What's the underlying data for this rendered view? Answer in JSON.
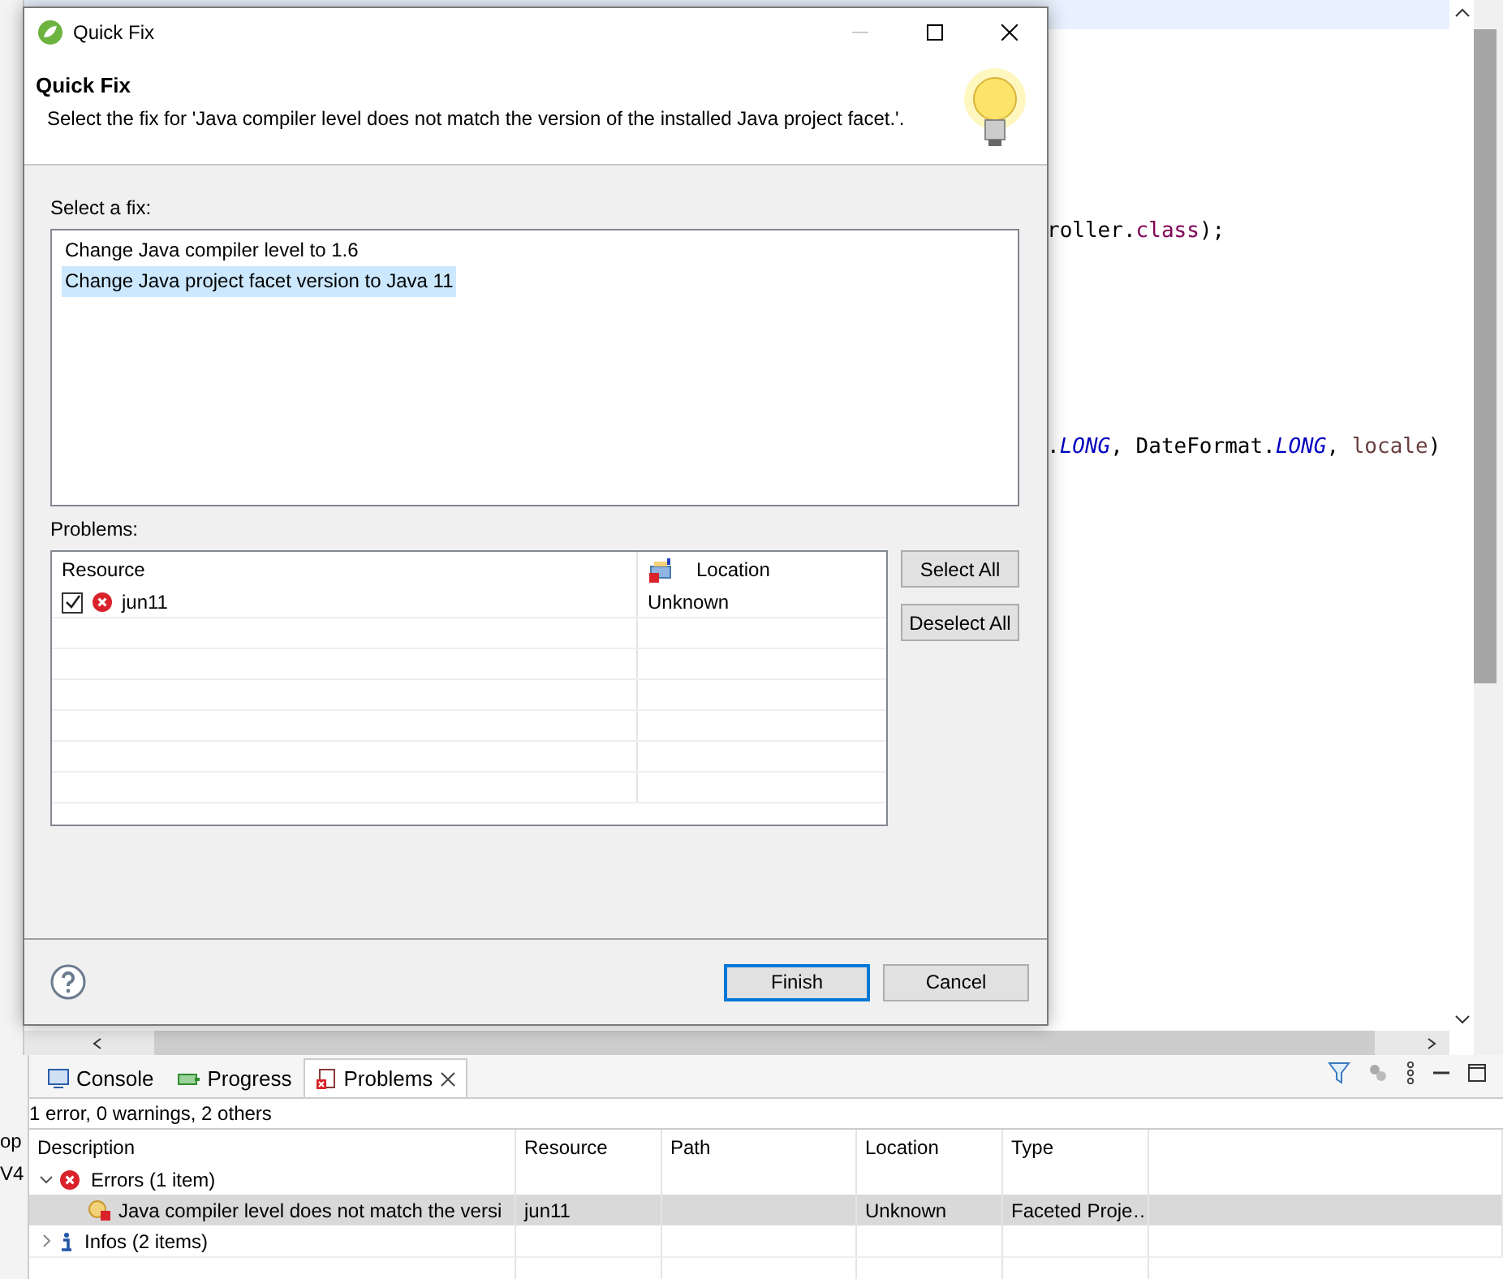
{
  "editor": {
    "lines": [
      {
        "segments": [
          {
            "text": "roller.",
            "kind": "plain"
          },
          {
            "text": "class",
            "kind": "keyword"
          },
          {
            "text": ");",
            "kind": "plain"
          }
        ]
      },
      {
        "segments": [
          {
            "text": ".",
            "kind": "plain"
          },
          {
            "text": "LONG",
            "kind": "constant"
          },
          {
            "text": ", DateFormat.",
            "kind": "plain"
          },
          {
            "text": "LONG",
            "kind": "constant"
          },
          {
            "text": ", ",
            "kind": "plain"
          },
          {
            "text": "locale",
            "kind": "variable"
          },
          {
            "text": ")",
            "kind": "plain"
          }
        ]
      }
    ]
  },
  "side_fragments": [
    "op",
    "V4"
  ],
  "dialog": {
    "title": "Quick Fix",
    "heading": "Quick Fix",
    "description": "Select the fix for 'Java compiler level does not match the version of the installed Java project facet.'.",
    "fix_label": "Select a fix:",
    "fixes": [
      {
        "label": "Change Java compiler level to 1.6",
        "selected": false
      },
      {
        "label": "Change Java project facet version to Java 11",
        "selected": true
      }
    ],
    "problems_label": "Problems:",
    "problems_table": {
      "columns": [
        "Resource",
        "Location"
      ],
      "rows": [
        {
          "checked": true,
          "resource": "jun11",
          "location": "Unknown"
        }
      ]
    },
    "side_buttons": [
      "Select All",
      "Deselect All"
    ],
    "buttons": [
      {
        "label": "Finish",
        "default": true
      },
      {
        "label": "Cancel",
        "default": false
      }
    ]
  },
  "bottom_panel": {
    "tabs": [
      {
        "label": "Console",
        "selected": false
      },
      {
        "label": "Progress",
        "selected": false
      },
      {
        "label": "Problems",
        "selected": true
      }
    ],
    "summary": "1 error, 0 warnings, 2 others",
    "columns": [
      "Description",
      "Resource",
      "Path",
      "Location",
      "Type"
    ],
    "groups": [
      {
        "kind": "error",
        "label": "Errors (1 item)",
        "expanded": true,
        "children": [
          {
            "description": "Java compiler level does not match the versi",
            "resource": "jun11",
            "location": "Unknown",
            "type": "Faceted Proje…",
            "selected": true
          }
        ]
      },
      {
        "kind": "info",
        "label": "Infos (2 items)",
        "expanded": false
      }
    ]
  }
}
